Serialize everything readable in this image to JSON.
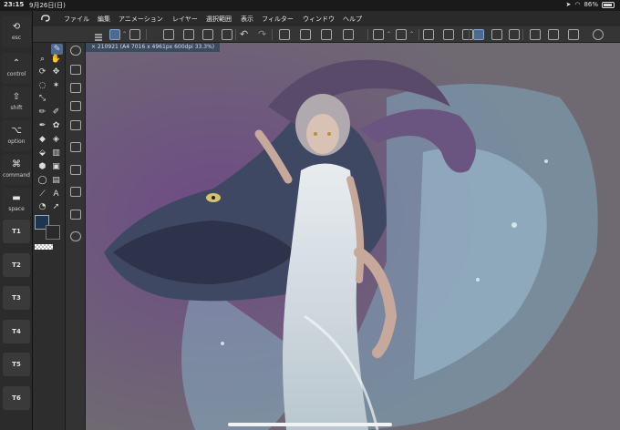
{
  "status_bar": {
    "time": "23:15",
    "date": "9月26日(日)",
    "battery": "86%",
    "battery_level": 0.86
  },
  "modifier_keys": [
    {
      "symbol": "⟲",
      "label": "esc"
    },
    {
      "symbol": "⌃",
      "label": "control"
    },
    {
      "symbol": "⇧",
      "label": "shift"
    },
    {
      "symbol": "⌥",
      "label": "option"
    },
    {
      "symbol": "⌘",
      "label": "command"
    },
    {
      "symbol": "▬",
      "label": "space"
    }
  ],
  "tab_keys": [
    "T1",
    "T2",
    "T3",
    "T4",
    "T5",
    "T6"
  ],
  "menu": [
    "ファイル",
    "編集",
    "アニメーション",
    "レイヤー",
    "選択範囲",
    "表示",
    "フィルター",
    "ウィンドウ",
    "ヘルプ"
  ],
  "canvas": {
    "tab_label": "× 210921 (A4 7016 x 4961px 600dpi 33.3%)"
  },
  "colors": {
    "main": "#1e3550",
    "sub": "#2a2a2a",
    "accent": "#4f6a8f"
  },
  "icons": {
    "app_logo": "clip-studio-logo",
    "toolbar": [
      "hamburger-menu-icon",
      "new-layer-icon",
      "layer-property-icon",
      "new-file-icon",
      "open-file-icon",
      "save-icon",
      "export-icon",
      "undo-icon",
      "redo-icon",
      "transform-icon",
      "selection-icon",
      "fill-icon",
      "crop-icon",
      "ruler-icon",
      "snap-icon",
      "reference-icon",
      "brush-size-icon",
      "pen-pressure-icon",
      "stabilizer-icon",
      "eraser-icon",
      "color-mix-icon",
      "vector-icon",
      "layer-mode-icon",
      "help-icon"
    ]
  }
}
